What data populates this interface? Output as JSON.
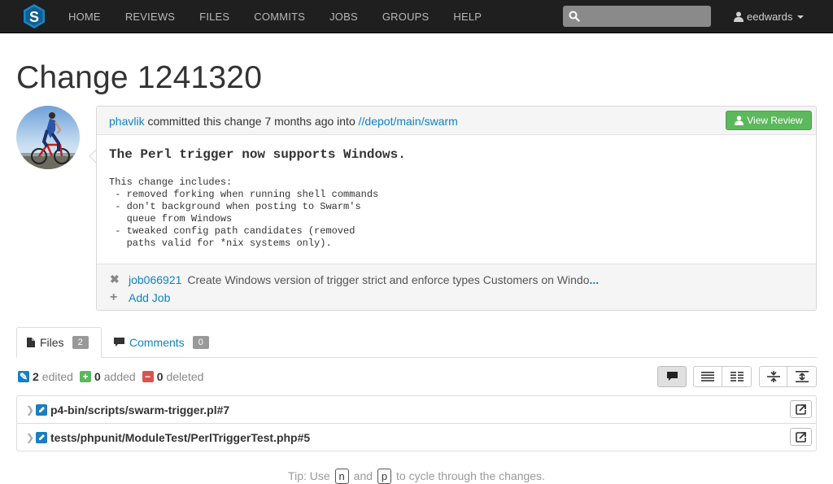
{
  "nav": {
    "items": [
      "HOME",
      "REVIEWS",
      "FILES",
      "COMMITS",
      "JOBS",
      "GROUPS",
      "HELP"
    ],
    "search_placeholder": "",
    "user": "eedwards"
  },
  "page": {
    "title": "Change 1241320"
  },
  "change": {
    "author": "phavlik",
    "action_text": " committed this change 7 months ago into ",
    "path": "//depot/main/swarm",
    "view_review_label": "View Review",
    "description_title": "The Perl trigger now supports Windows.",
    "description_lines": [
      "This change includes:",
      " - removed forking when running shell commands",
      " - don't background when posting to Swarm's",
      "   queue from Windows",
      " - tweaked config path candidates (removed",
      "   paths valid for *nix systems only)."
    ],
    "job": {
      "id": "job066921",
      "description": "Create Windows version of trigger strict and enforce types Customers on Windo",
      "ellipsis": "..."
    },
    "add_job_label": "Add Job"
  },
  "tabs": {
    "files": {
      "label": "Files",
      "count": "2"
    },
    "comments": {
      "label": "Comments",
      "count": "0"
    }
  },
  "stats": {
    "edited": {
      "count": "2",
      "label": "edited"
    },
    "added": {
      "count": "0",
      "label": "added"
    },
    "deleted": {
      "count": "0",
      "label": "deleted"
    }
  },
  "files": [
    {
      "name": "p4-bin/scripts/swarm-trigger.pl#7"
    },
    {
      "name": "tests/phpunit/ModuleTest/PerlTriggerTest.php#5"
    }
  ],
  "tip": {
    "prefix": "Tip: Use",
    "key1": "n",
    "and": "and",
    "key2": "p",
    "suffix": "to cycle through the changes."
  },
  "colors": {
    "navbar": "#1f1f1f",
    "link": "#0d83c2",
    "review_button": "#5cb85c",
    "edited": "#1a7ec2",
    "added": "#5cb85c",
    "deleted": "#d9534f"
  }
}
